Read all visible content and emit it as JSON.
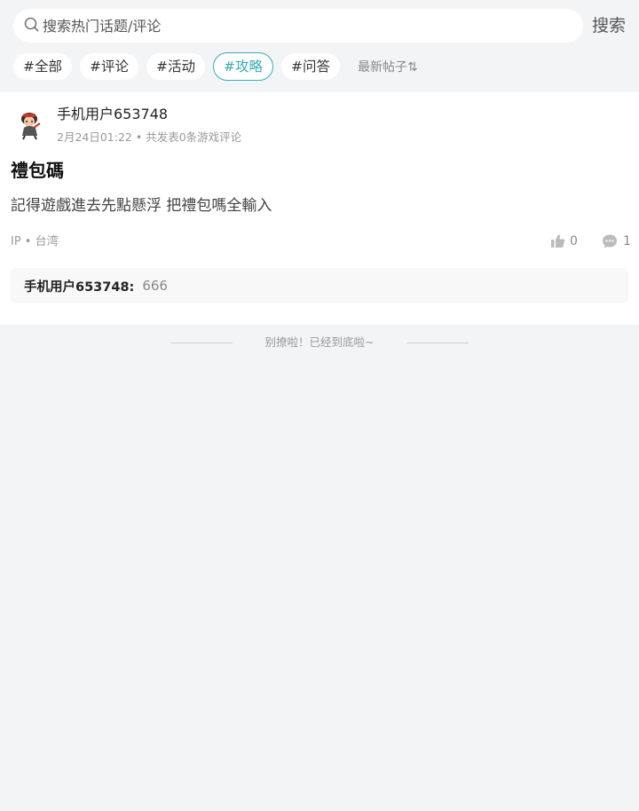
{
  "search": {
    "placeholder": "搜索热门话题/评论",
    "button_label": "搜索"
  },
  "tags": [
    {
      "label": "#全部",
      "active": false
    },
    {
      "label": "#评论",
      "active": false
    },
    {
      "label": "#活动",
      "active": false
    },
    {
      "label": "#攻略",
      "active": true
    },
    {
      "label": "#问答",
      "active": false
    }
  ],
  "sort_label": "最新帖子⇅",
  "post": {
    "username": "手机用户653748",
    "meta": "2月24日01:22 • 共发表0条游戏评论",
    "title": "禮包碼",
    "body": "記得遊戲進去先點懸浮 把禮包嗎全輸入",
    "ip": "IP • 台湾",
    "like_count": "0",
    "comment_count": "1",
    "reply": {
      "user": "手机用户653748:",
      "text": "666"
    }
  },
  "end_text": "别撩啦！已经到底啦~",
  "colors": {
    "accent": "#3aaab3",
    "background": "#f3f4f6"
  }
}
